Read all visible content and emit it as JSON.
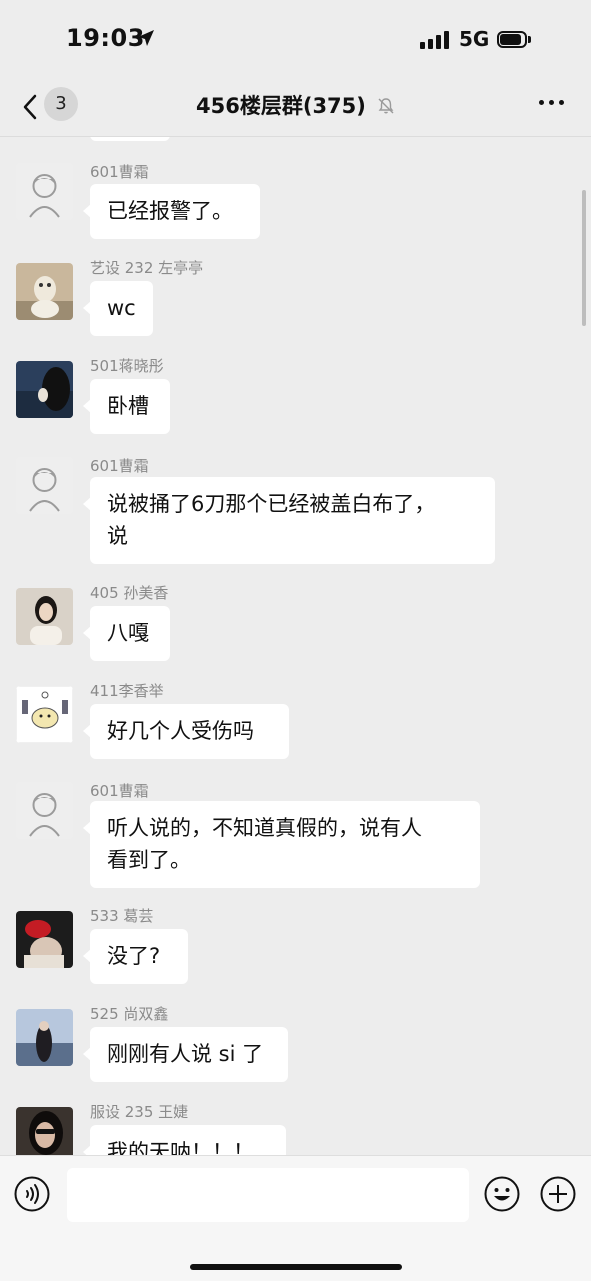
{
  "status_bar": {
    "time": "19:03",
    "network": "5G"
  },
  "nav": {
    "unread_count": "3",
    "title": "456楼层群(375)",
    "back_icon": "chevron-left-icon",
    "mute_icon": "bell-off-icon",
    "more_icon": "more-dots-icon"
  },
  "messages": [
    {
      "sender": "601曹霜",
      "text": "已经报警了。",
      "avatar": "default-avatar"
    },
    {
      "sender": "艺设 232 左亭亭",
      "text": "wc",
      "avatar": "dog-photo-avatar"
    },
    {
      "sender": "501蒋晓彤",
      "text": "卧槽",
      "avatar": "portrait-avatar"
    },
    {
      "sender": "601曹霜",
      "text": "说被捅了6刀那个已经被盖白布了，\n说",
      "avatar": "default-avatar"
    },
    {
      "sender": "405 孙美香",
      "text": "八嘎",
      "avatar": "portrait-avatar"
    },
    {
      "sender": "411李香举",
      "text": "好几个人受伤吗",
      "avatar": "cartoon-avatar"
    },
    {
      "sender": "601曹霜",
      "text": "听人说的，不知道真假的，说有人\n看到了。",
      "avatar": "default-avatar"
    },
    {
      "sender": "533 葛芸",
      "text": "没了?",
      "avatar": "portrait-avatar"
    },
    {
      "sender": "525 尚双鑫",
      "text": "刚刚有人说 si 了",
      "avatar": "landscape-avatar"
    },
    {
      "sender": "服设 235 王婕",
      "text": "我的天呐！！！",
      "avatar": "portrait-avatar"
    }
  ],
  "input_bar": {
    "placeholder": "",
    "voice_icon": "voice-icon",
    "emoji_icon": "emoji-icon",
    "plus_icon": "plus-circle-icon"
  },
  "colors": {
    "background": "#ededed",
    "bubble": "#ffffff",
    "sender_name": "#8a8a8a"
  }
}
